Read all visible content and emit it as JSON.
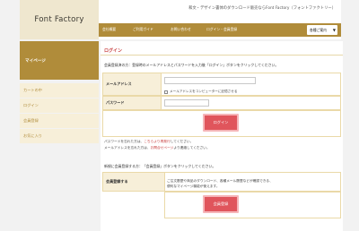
{
  "header": {
    "logo": "Font Factory",
    "tagline": "和文・デザイン書体のダウンロード販売ならFont Factory（フォントファクトリー）",
    "nav": [
      {
        "label": "会社概要"
      },
      {
        "label": "ご利用ガイド"
      },
      {
        "label": "お問い合わせ"
      },
      {
        "label": "ログイン・会員登録"
      }
    ],
    "select": "各種ご案内",
    "select_arrow": "▼"
  },
  "sidebar": {
    "title": "マイページ",
    "items": [
      {
        "label": "カートの中"
      },
      {
        "label": "ログイン"
      },
      {
        "label": "会員登録"
      },
      {
        "label": "お気に入り"
      }
    ]
  },
  "main": {
    "title": "ログイン",
    "member_instruction": "会員登録済の方：登録時のメールアドレスとパスワードを入力後「ログイン」ボタンをクリックしてください。",
    "email_label": "メールアドレス",
    "email_value": "",
    "remember_label": "メールアドレスをコンピューターに記憶させる",
    "password_label": "パスワード",
    "password_value": "",
    "login_button": "ログイン",
    "forgot_prefix": "パスワードを忘れた方は、",
    "forgot_link": "こちらより再発行",
    "forgot_suffix": "してください。",
    "forgot_email_prefix": "メールアドレスを忘れた方は、",
    "forgot_email_link": "お問合せページ",
    "forgot_email_suffix": "より連絡してください。",
    "new_instruction": "新規に会員登録する方：「会員登録」ボタンをクリックしてください。",
    "register_label": "会員登録する",
    "register_desc_1": "ご注文履歴や商品のダウンロード、各種メール履歴などが確認できる、",
    "register_desc_2": "便利なマイページ機能が使えます。",
    "register_button": "会員登録"
  },
  "colors": {
    "accent": "#b08c3a",
    "button": "#e0555c",
    "link": "#c63a3a",
    "label_bg": "#f7efd9"
  }
}
